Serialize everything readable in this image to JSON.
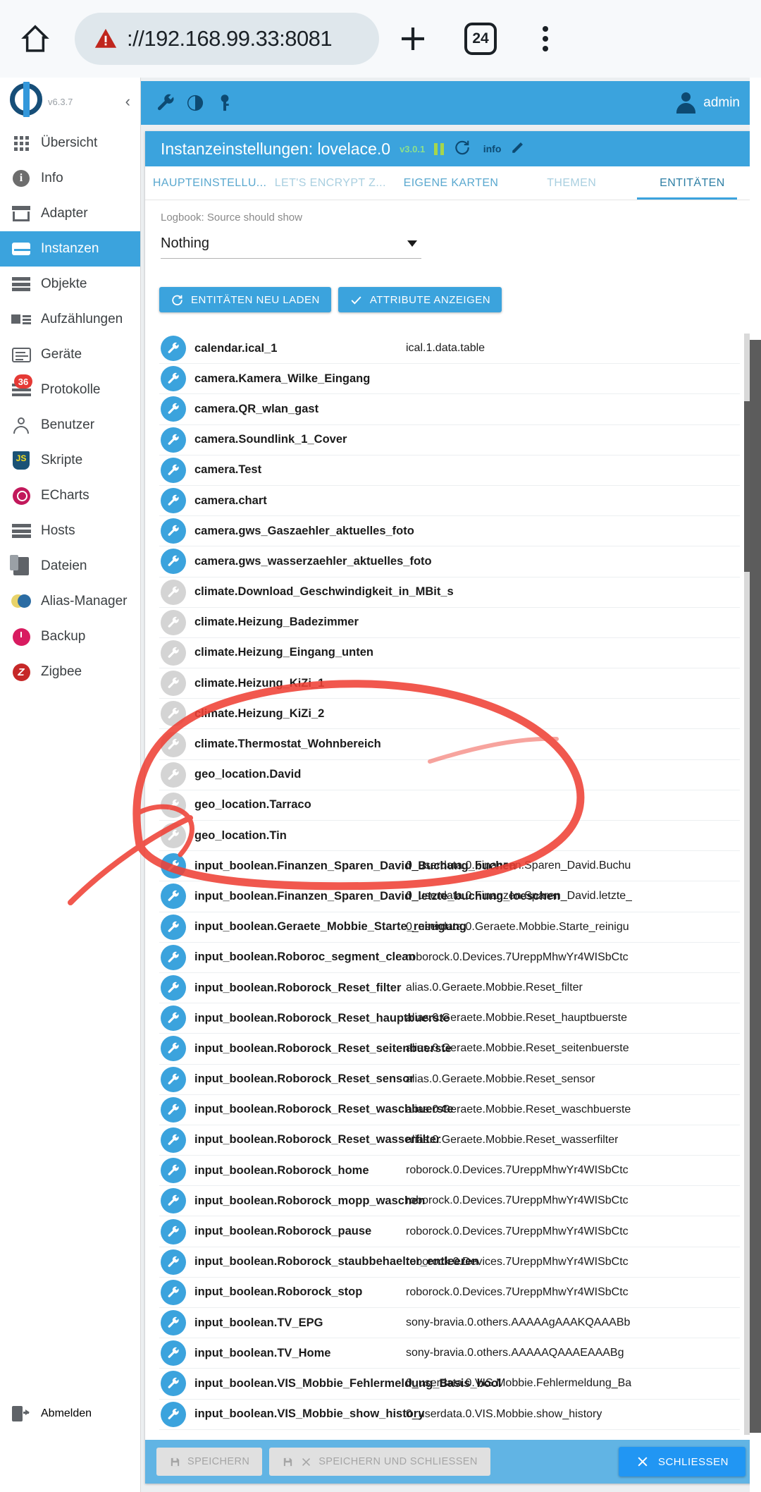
{
  "browser": {
    "home_icon": "home-icon",
    "security_icon": "insecure-warning-icon",
    "url_scheme": "://",
    "url_host": "192.168.99.33",
    "url_port": ":8081",
    "url_full": "://192.168.99.33:8081",
    "new_tab_icon": "plus-icon",
    "tab_count": "24",
    "menu_icon": "kebab-menu-icon"
  },
  "sidebar": {
    "version": "v6.3.7",
    "collapse_icon": "chevron-left-icon",
    "items": [
      {
        "label": "Übersicht",
        "icon": "grid-icon",
        "active": false
      },
      {
        "label": "Info",
        "icon": "info-icon",
        "active": false
      },
      {
        "label": "Adapter",
        "icon": "shop-icon",
        "active": false
      },
      {
        "label": "Instanzen",
        "icon": "instances-icon",
        "active": true
      },
      {
        "label": "Objekte",
        "icon": "list-icon",
        "active": false
      },
      {
        "label": "Aufzählungen",
        "icon": "enumeration-icon",
        "active": false
      },
      {
        "label": "Geräte",
        "icon": "device-icon",
        "active": false
      },
      {
        "label": "Protokolle",
        "icon": "log-icon",
        "active": false,
        "badge": "36"
      },
      {
        "label": "Benutzer",
        "icon": "user-icon",
        "active": false
      },
      {
        "label": "Skripte",
        "icon": "javascript-icon",
        "active": false
      },
      {
        "label": "ECharts",
        "icon": "echarts-icon",
        "active": false
      },
      {
        "label": "Hosts",
        "icon": "hosts-icon",
        "active": false
      },
      {
        "label": "Dateien",
        "icon": "files-icon",
        "active": false
      },
      {
        "label": "Alias-Manager",
        "icon": "alias-icon",
        "active": false
      },
      {
        "label": "Backup",
        "icon": "backup-icon",
        "active": false
      },
      {
        "label": "Zigbee",
        "icon": "zigbee-icon",
        "active": false
      }
    ],
    "logout": {
      "label": "Abmelden",
      "icon": "logout-icon"
    }
  },
  "toolbar": {
    "icons": [
      "wrench-icon",
      "contrast-icon",
      "key-icon"
    ],
    "user": "admin",
    "avatar_icon": "avatar-icon"
  },
  "panel": {
    "title": "Instanzeinstellungen: lovelace.0",
    "version": "v3.0.1",
    "pause_icon": "pause-icon",
    "refresh_icon": "refresh-icon",
    "info_label": "info",
    "edit_icon": "pencil-icon"
  },
  "tabs": [
    {
      "label": "HAUPTEINSTELLU...",
      "state": "normal"
    },
    {
      "label": "LET'S ENCRYPT Z...",
      "state": "muted"
    },
    {
      "label": "EIGENE KARTEN",
      "state": "normal"
    },
    {
      "label": "THEMEN",
      "state": "muted"
    },
    {
      "label": "ENTITÄTEN",
      "state": "active"
    }
  ],
  "form": {
    "label": "Logbook: Source should show",
    "select_value": "Nothing",
    "select_caret_icon": "caret-down-icon"
  },
  "buttons": {
    "reload_entities": {
      "label": "ENTITÄTEN NEU LADEN",
      "icon": "refresh-icon"
    },
    "show_attributes": {
      "label": "ATTRIBUTE ANZEIGEN",
      "icon": "check-icon"
    }
  },
  "entities": [
    {
      "name": "calendar.ical_1",
      "value": "ical.1.data.table",
      "enabled": true
    },
    {
      "name": "camera.Kamera_Wilke_Eingang",
      "value": "",
      "enabled": true
    },
    {
      "name": "camera.QR_wlan_gast",
      "value": "",
      "enabled": true
    },
    {
      "name": "camera.Soundlink_1_Cover",
      "value": "",
      "enabled": true
    },
    {
      "name": "camera.Test",
      "value": "",
      "enabled": true
    },
    {
      "name": "camera.chart",
      "value": "",
      "enabled": true
    },
    {
      "name": "camera.gws_Gaszaehler_aktuelles_foto",
      "value": "",
      "enabled": true
    },
    {
      "name": "camera.gws_wasserzaehler_aktuelles_foto",
      "value": "",
      "enabled": true
    },
    {
      "name": "climate.Download_Geschwindigkeit_in_MBit_s",
      "value": "",
      "enabled": false
    },
    {
      "name": "climate.Heizung_Badezimmer",
      "value": "",
      "enabled": false
    },
    {
      "name": "climate.Heizung_Eingang_unten",
      "value": "",
      "enabled": false
    },
    {
      "name": "climate.Heizung_KiZi_1",
      "value": "",
      "enabled": false
    },
    {
      "name": "climate.Heizung_KiZi_2",
      "value": "",
      "enabled": false
    },
    {
      "name": "climate.Thermostat_Wohnbereich",
      "value": "",
      "enabled": false
    },
    {
      "name": "geo_location.David",
      "value": "",
      "enabled": false
    },
    {
      "name": "geo_location.Tarraco",
      "value": "",
      "enabled": false
    },
    {
      "name": "geo_location.Tin",
      "value": "",
      "enabled": false
    },
    {
      "name": "input_boolean.Finanzen_Sparen_David_Buchung_buchen",
      "value": "0_userdata.0.Finanzen.Sparen_David.Buchu",
      "enabled": true
    },
    {
      "name": "input_boolean.Finanzen_Sparen_David_letzte_buchung_loeschen",
      "value": "0_userdata.0.Finanzen.Sparen_David.letzte_",
      "enabled": true
    },
    {
      "name": "input_boolean.Geraete_Mobbie_Starte_reinigung",
      "value": "0_userdata.0.Geraete.Mobbie.Starte_reinigu",
      "enabled": true
    },
    {
      "name": "input_boolean.Roboroc_segment_clean",
      "value": "roborock.0.Devices.7UreppMhwYr4WISbCtc",
      "enabled": true
    },
    {
      "name": "input_boolean.Roborock_Reset_filter",
      "value": "alias.0.Geraete.Mobbie.Reset_filter",
      "enabled": true
    },
    {
      "name": "input_boolean.Roborock_Reset_hauptbuerste",
      "value": "alias.0.Geraete.Mobbie.Reset_hauptbuerste",
      "enabled": true
    },
    {
      "name": "input_boolean.Roborock_Reset_seitenbuerste",
      "value": "alias.0.Geraete.Mobbie.Reset_seitenbuerste",
      "enabled": true
    },
    {
      "name": "input_boolean.Roborock_Reset_sensor",
      "value": "alias.0.Geraete.Mobbie.Reset_sensor",
      "enabled": true
    },
    {
      "name": "input_boolean.Roborock_Reset_waschbuerste",
      "value": "alias.0.Geraete.Mobbie.Reset_waschbuerste",
      "enabled": true
    },
    {
      "name": "input_boolean.Roborock_Reset_wasserfilter",
      "value": "alias.0.Geraete.Mobbie.Reset_wasserfilter",
      "enabled": true
    },
    {
      "name": "input_boolean.Roborock_home",
      "value": "roborock.0.Devices.7UreppMhwYr4WISbCtc",
      "enabled": true
    },
    {
      "name": "input_boolean.Roborock_mopp_waschen",
      "value": "roborock.0.Devices.7UreppMhwYr4WISbCtc",
      "enabled": true
    },
    {
      "name": "input_boolean.Roborock_pause",
      "value": "roborock.0.Devices.7UreppMhwYr4WISbCtc",
      "enabled": true
    },
    {
      "name": "input_boolean.Roborock_staubbehaelter_entleeren",
      "value": "roborock.0.Devices.7UreppMhwYr4WISbCtc",
      "enabled": true
    },
    {
      "name": "input_boolean.Roborock_stop",
      "value": "roborock.0.Devices.7UreppMhwYr4WISbCtc",
      "enabled": true
    },
    {
      "name": "input_boolean.TV_EPG",
      "value": "sony-bravia.0.others.AAAAAgAAAKQAAABb",
      "enabled": true
    },
    {
      "name": "input_boolean.TV_Home",
      "value": "sony-bravia.0.others.AAAAAQAAAEAAABg",
      "enabled": true
    },
    {
      "name": "input_boolean.VIS_Mobbie_Fehlermeldung_Basis_bool",
      "value": "0_userdata.0.VIS.Mobbie.Fehlermeldung_Ba",
      "enabled": true
    },
    {
      "name": "input_boolean.VIS_Mobbie_show_history",
      "value": "0_userdata.0.VIS.Mobbie.show_history",
      "enabled": true
    }
  ],
  "bottom_bar": {
    "save": {
      "label": "SPEICHERN",
      "icon": "save-icon",
      "disabled": true
    },
    "save_close": {
      "label": "SPEICHERN UND SCHLIESSEN",
      "icon": "save-close-icon",
      "disabled": true
    },
    "close": {
      "label": "SCHLIESSEN",
      "icon": "close-icon",
      "disabled": false
    }
  },
  "annotation": {
    "color": "#ef4136",
    "shape": "ellipse-with-arrow",
    "targets": "greyed-out climate and geo_location entity rows"
  },
  "colors": {
    "accent": "#3ba3dd",
    "accent_dark": "#0d4a72",
    "badge": "#e53935",
    "annotation": "#ef4136"
  }
}
